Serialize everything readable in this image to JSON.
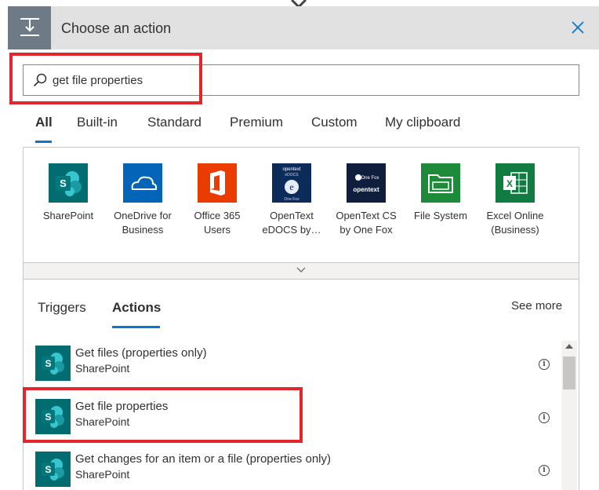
{
  "header": {
    "title": "Choose an action",
    "icon": "flow-step-icon",
    "close_icon": "close-icon"
  },
  "search": {
    "value": "get file properties",
    "icon": "search-icon"
  },
  "tabs": [
    {
      "label": "All",
      "active": true
    },
    {
      "label": "Built-in",
      "active": false
    },
    {
      "label": "Standard",
      "active": false
    },
    {
      "label": "Premium",
      "active": false
    },
    {
      "label": "Custom",
      "active": false
    },
    {
      "label": "My clipboard",
      "active": false
    }
  ],
  "connectors": [
    {
      "label": "SharePoint",
      "color": "#036c70"
    },
    {
      "label": "OneDrive for Business",
      "color": "#0364b8"
    },
    {
      "label": "Office 365 Users",
      "color": "#eb3c00"
    },
    {
      "label": "OpenText eDOCS by…",
      "color": "#0b2b5a"
    },
    {
      "label": "OpenText CS by One Fox",
      "color": "#0f1e3c"
    },
    {
      "label": "File System",
      "color": "#1e8b3a"
    },
    {
      "label": "Excel Online (Business)",
      "color": "#107c41"
    }
  ],
  "subtabs": [
    {
      "label": "Triggers",
      "active": false
    },
    {
      "label": "Actions",
      "active": true
    }
  ],
  "see_more": "See more",
  "actions": [
    {
      "name": "Get files (properties only)",
      "connector": "SharePoint"
    },
    {
      "name": "Get file properties",
      "connector": "SharePoint"
    },
    {
      "name": "Get changes for an item or a file (properties only)",
      "connector": "SharePoint"
    }
  ],
  "colors": {
    "accent": "#0078d4",
    "highlight": "#e3262d",
    "sharepoint": "#036c70"
  }
}
